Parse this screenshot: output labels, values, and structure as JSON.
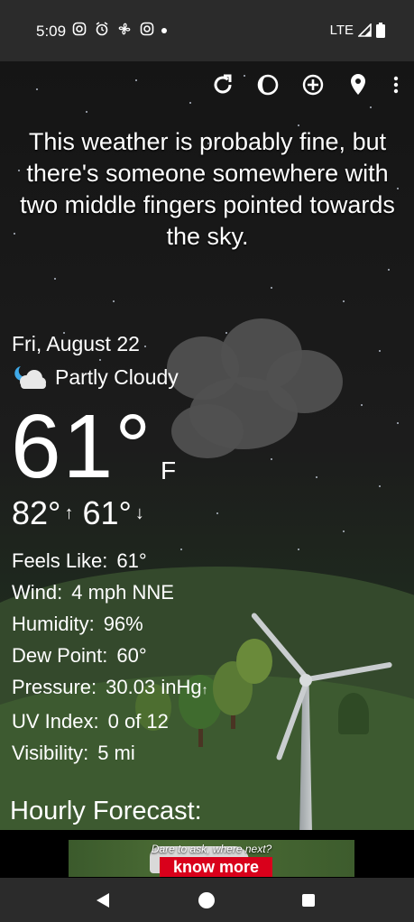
{
  "status_bar": {
    "time": "5:09",
    "network": "LTE",
    "icons": [
      "instagram-icon",
      "alarm-icon",
      "fan-icon",
      "instagram-icon",
      "notification-dot"
    ]
  },
  "toolbar": {
    "icons": [
      "refresh-icon",
      "moon-phase-icon",
      "add-location-icon",
      "location-pin-icon",
      "more-vert-icon"
    ]
  },
  "headline": "This weather is probably fine, but there's someone somewhere with two middle fingers pointed towards the sky.",
  "current": {
    "date": "Fri, August 22",
    "condition": "Partly Cloudy",
    "condition_icon": "partly-cloudy-night-icon",
    "temperature": "61°",
    "unit": "F",
    "high": "82°",
    "low": "61°"
  },
  "details": [
    {
      "label": "Feels Like:",
      "value": "61°"
    },
    {
      "label": "Wind:",
      "value": "4 mph NNE"
    },
    {
      "label": "Humidity:",
      "value": "96%"
    },
    {
      "label": "Dew Point:",
      "value": "60°"
    },
    {
      "label": "Pressure:",
      "value": "30.03 inHg",
      "trend": "↑"
    },
    {
      "label": "UV Index:",
      "value": "0 of 12"
    },
    {
      "label": "Visibility:",
      "value": "5 mi"
    }
  ],
  "hourly_heading": "Hourly Forecast:",
  "ad": {
    "tagline": "Dare to ask, where next?",
    "button": "know more"
  },
  "colors": {
    "status_bar": "#2b2b2b",
    "sky": "#1c1c1c",
    "grass": "#3d5a30",
    "ad_button": "#d9001b"
  }
}
